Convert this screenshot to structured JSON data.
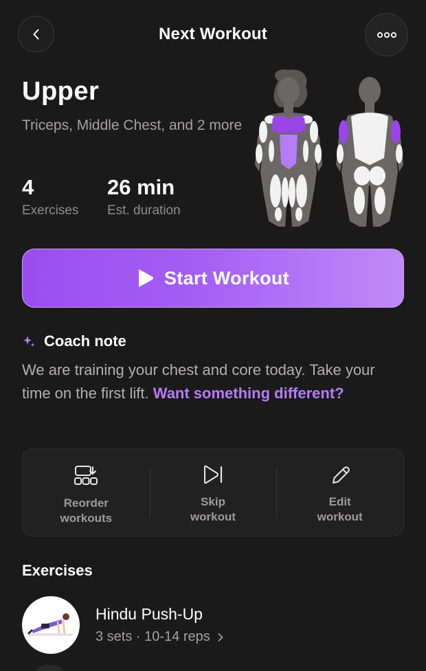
{
  "header": {
    "title": "Next Workout",
    "back_icon": "chevron-left-icon",
    "more_icon": "more-horizontal-icon"
  },
  "workout": {
    "name": "Upper",
    "muscles": "Triceps, Middle Chest, and 2 more",
    "exercise_count": "4",
    "exercise_count_label": "Exercises",
    "duration": "26 min",
    "duration_label": "Est. duration",
    "highlight_color": "#9b45e8"
  },
  "start_button": {
    "label": "Start Workout",
    "icon": "play-icon",
    "gradient": [
      "#9a4df0",
      "#c08af8"
    ]
  },
  "coach_note": {
    "icon": "sparkle-icon",
    "title": "Coach note",
    "text": "We are training your chest and core today. Take your time on the first lift.",
    "link": "Want something different?",
    "accent": "#b57cf6"
  },
  "actions": [
    {
      "icon": "reorder-icon",
      "line1": "Reorder",
      "line2": "workouts"
    },
    {
      "icon": "skip-icon",
      "line1": "Skip",
      "line2": "workout"
    },
    {
      "icon": "pencil-icon",
      "line1": "Edit",
      "line2": "workout"
    }
  ],
  "exercises_section": {
    "title": "Exercises",
    "items": [
      {
        "name": "Hindu Push-Up",
        "meta": "3 sets · 10-14 reps",
        "icon": "chevron-right-icon"
      }
    ]
  }
}
